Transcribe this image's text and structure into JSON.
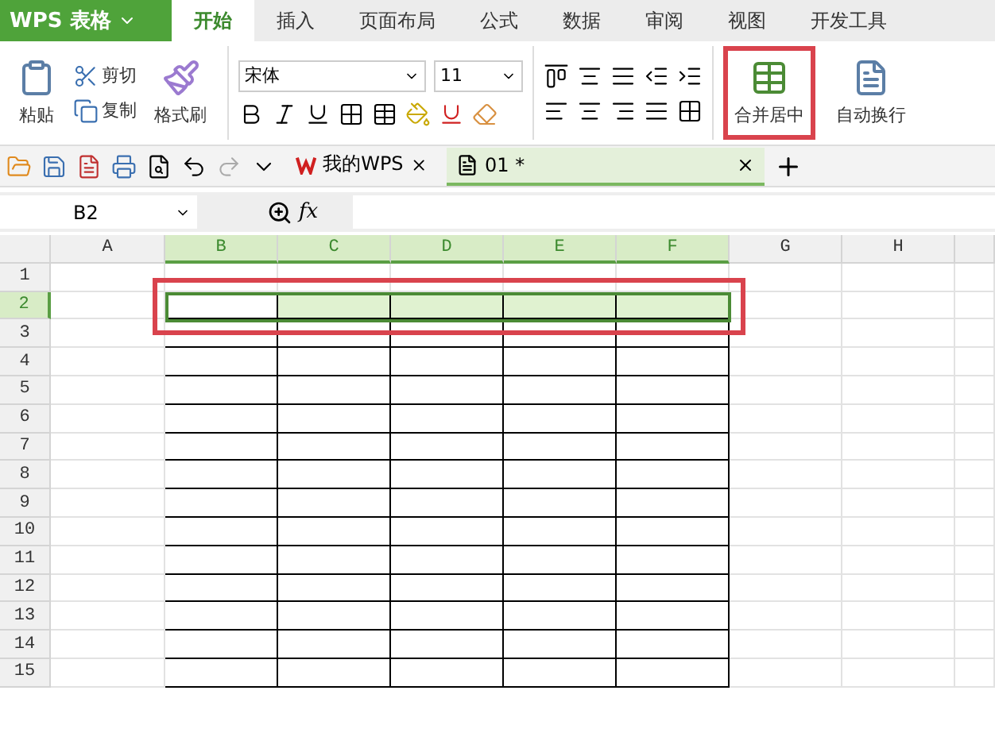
{
  "app_menu": {
    "label": "WPS 表格"
  },
  "tabs": [
    {
      "label": "开始",
      "selected": true
    },
    {
      "label": "插入",
      "selected": false
    },
    {
      "label": "页面布局",
      "selected": false
    },
    {
      "label": "公式",
      "selected": false
    },
    {
      "label": "数据",
      "selected": false
    },
    {
      "label": "审阅",
      "selected": false
    },
    {
      "label": "视图",
      "selected": false
    },
    {
      "label": "开发工具",
      "selected": false
    }
  ],
  "clipboard": {
    "paste": "粘贴",
    "cut": "剪切",
    "copy": "复制",
    "format_painter": "格式刷"
  },
  "font": {
    "name": "宋体",
    "size": "11"
  },
  "merge_button": {
    "label": "合并居中",
    "highlighted": true
  },
  "wrap_button": {
    "label": "自动换行"
  },
  "doc_tabs": [
    {
      "label": "我的WPS",
      "kind": "home",
      "selected": false
    },
    {
      "label": "01 *",
      "kind": "doc",
      "selected": true
    }
  ],
  "name_box": {
    "value": "B2"
  },
  "function_button": {
    "label": "fx"
  },
  "columns": [
    {
      "label": "A",
      "selected": false,
      "bordered": false
    },
    {
      "label": "B",
      "selected": true,
      "bordered": true
    },
    {
      "label": "C",
      "selected": true,
      "bordered": true
    },
    {
      "label": "D",
      "selected": true,
      "bordered": true
    },
    {
      "label": "E",
      "selected": true,
      "bordered": true
    },
    {
      "label": "F",
      "selected": true,
      "bordered": true
    },
    {
      "label": "G",
      "selected": false,
      "bordered": false
    },
    {
      "label": "H",
      "selected": false,
      "bordered": false
    }
  ],
  "rows": [
    {
      "label": "1",
      "selected": false,
      "bordered": false
    },
    {
      "label": "2",
      "selected": true,
      "bordered": true
    },
    {
      "label": "3",
      "selected": false,
      "bordered": true
    },
    {
      "label": "4",
      "selected": false,
      "bordered": true
    },
    {
      "label": "5",
      "selected": false,
      "bordered": true
    },
    {
      "label": "6",
      "selected": false,
      "bordered": true
    },
    {
      "label": "7",
      "selected": false,
      "bordered": true
    },
    {
      "label": "8",
      "selected": false,
      "bordered": true
    },
    {
      "label": "9",
      "selected": false,
      "bordered": true
    },
    {
      "label": "10",
      "selected": false,
      "bordered": true
    },
    {
      "label": "11",
      "selected": false,
      "bordered": true
    },
    {
      "label": "12",
      "selected": false,
      "bordered": true
    },
    {
      "label": "13",
      "selected": false,
      "bordered": true
    },
    {
      "label": "14",
      "selected": false,
      "bordered": true
    },
    {
      "label": "15",
      "selected": false,
      "bordered": true
    }
  ],
  "selection_highlighted": true
}
